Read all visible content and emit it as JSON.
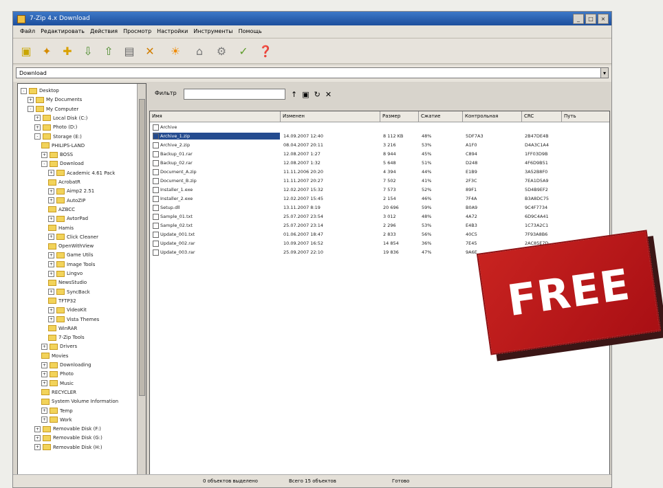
{
  "window": {
    "title": "7-Zip 4.x Download",
    "minimize_label": "_",
    "maximize_label": "□",
    "close_label": "×"
  },
  "menu": [
    "Файл",
    "Редактировать",
    "Действия",
    "Просмотр",
    "Настройки",
    "Инструменты",
    "Помощь"
  ],
  "address": {
    "value": "Download",
    "dropdown_label": "▾"
  },
  "filter": {
    "label": "Фильтр",
    "value": ""
  },
  "tree": [
    {
      "label": "Desktop",
      "level": 0,
      "expander": "-"
    },
    {
      "label": "My Documents",
      "level": 1,
      "expander": "+"
    },
    {
      "label": "My Computer",
      "level": 1,
      "expander": "-"
    },
    {
      "label": "Local Disk (C:)",
      "level": 2,
      "expander": "+"
    },
    {
      "label": "Photo (D:)",
      "level": 2,
      "expander": "+"
    },
    {
      "label": "Storage (E:)",
      "level": 2,
      "expander": "-"
    },
    {
      "label": "PHILIPS-LAND",
      "level": 3,
      "expander": ""
    },
    {
      "label": "BOSS",
      "level": 3,
      "expander": "+"
    },
    {
      "label": "Download",
      "level": 3,
      "expander": "-"
    },
    {
      "label": "Academic 4.61 Pack",
      "level": 4,
      "expander": "+"
    },
    {
      "label": "AcrobatR",
      "level": 4,
      "expander": ""
    },
    {
      "label": "Aimp2 2.51",
      "level": 4,
      "expander": "+"
    },
    {
      "label": "AutoZIP",
      "level": 4,
      "expander": "+"
    },
    {
      "label": "AZBCC",
      "level": 4,
      "expander": ""
    },
    {
      "label": "AvtorPad",
      "level": 4,
      "expander": "+"
    },
    {
      "label": "Hamis",
      "level": 4,
      "expander": ""
    },
    {
      "label": "Click Cleaner",
      "level": 4,
      "expander": "+"
    },
    {
      "label": "OpenWithView",
      "level": 4,
      "expander": ""
    },
    {
      "label": "Game Utils",
      "level": 4,
      "expander": "+"
    },
    {
      "label": "Image Tools",
      "level": 4,
      "expander": "+"
    },
    {
      "label": "Lingvo",
      "level": 4,
      "expander": "+"
    },
    {
      "label": "NewsStudio",
      "level": 4,
      "expander": ""
    },
    {
      "label": "SyncBack",
      "level": 4,
      "expander": "+"
    },
    {
      "label": "TFTP32",
      "level": 4,
      "expander": ""
    },
    {
      "label": "VideoKit",
      "level": 4,
      "expander": "+"
    },
    {
      "label": "Vista Themes",
      "level": 4,
      "expander": "+"
    },
    {
      "label": "WinRAR",
      "level": 4,
      "expander": ""
    },
    {
      "label": "7-Zip Tools",
      "level": 4,
      "expander": ""
    },
    {
      "label": "Drivers",
      "level": 3,
      "expander": "+"
    },
    {
      "label": "Movies",
      "level": 3,
      "expander": ""
    },
    {
      "label": "Downloading",
      "level": 3,
      "expander": "+"
    },
    {
      "label": "Photo",
      "level": 3,
      "expander": "+"
    },
    {
      "label": "Music",
      "level": 3,
      "expander": "+"
    },
    {
      "label": "RECYCLER",
      "level": 3,
      "expander": ""
    },
    {
      "label": "System Volume Information",
      "level": 3,
      "expander": ""
    },
    {
      "label": "Temp",
      "level": 3,
      "expander": "+"
    },
    {
      "label": "Work",
      "level": 3,
      "expander": "+"
    },
    {
      "label": "Removable Disk (F:)",
      "level": 2,
      "expander": "+"
    },
    {
      "label": "Removable Disk (G:)",
      "level": 2,
      "expander": "+"
    },
    {
      "label": "Removable Disk (H:)",
      "level": 2,
      "expander": "+"
    }
  ],
  "table": {
    "headers": [
      "Имя",
      "Изменен",
      "Размер",
      "Сжатие",
      "Контрольная",
      "CRC",
      "Путь"
    ],
    "rows": [
      [
        "Archive",
        "",
        "",
        "",
        "",
        "",
        ""
      ],
      [
        "Archive_1.zip",
        "14.09.2007 12:40",
        "8 112 KB",
        "48%",
        "5DF7A3",
        "2B47DE4B",
        ""
      ],
      [
        "Archive_2.zip",
        "08.04.2007 20:11",
        "3 216",
        "53%",
        "A1F0",
        "D4A3C1A4",
        ""
      ],
      [
        "Backup_01.rar",
        "12.08.2007 1:27",
        "8 944",
        "45%",
        "C894",
        "1FF03D9B",
        ""
      ],
      [
        "Backup_02.rar",
        "12.08.2007 1:32",
        "5 648",
        "51%",
        "D248",
        "4F6D9B51",
        ""
      ],
      [
        "Document_A.zip",
        "11.11.2006 20:20",
        "4 394",
        "44%",
        "E1B9",
        "3A52B8F0",
        ""
      ],
      [
        "Document_B.zip",
        "11.11.2007 20:27",
        "7 502",
        "41%",
        "2F3C",
        "7EA1D5A9",
        ""
      ],
      [
        "Installer_1.exe",
        "12.02.2007 15:32",
        "7 573",
        "52%",
        "89F1",
        "5D4B9EF2",
        ""
      ],
      [
        "Installer_2.exe",
        "12.02.2007 15:45",
        "2 154",
        "46%",
        "7F4A",
        "B3A8DC75",
        ""
      ],
      [
        "Setup.dll",
        "13.11.2007 8:19",
        "20 696",
        "59%",
        "B0A9",
        "9C4F7734",
        ""
      ],
      [
        "Sample_01.txt",
        "25.07.2007 23:54",
        "3 012",
        "48%",
        "4A72",
        "6D9C4A41",
        ""
      ],
      [
        "Sample_02.txt",
        "25.07.2007 23:14",
        "2 296",
        "53%",
        "E4B3",
        "1C73A2C1",
        ""
      ],
      [
        "Update_001.txt",
        "01.06.2007 18:47",
        "2 833",
        "56%",
        "40C5",
        "7F93A8B6",
        ""
      ],
      [
        "Update_002.rar",
        "10.09.2007 16:52",
        "14 854",
        "36%",
        "7E45",
        "2AC85E7D",
        ""
      ],
      [
        "Update_003.rar",
        "25.09.2007 22:10",
        "19 836",
        "47%",
        "9A6E",
        "1B6A6F52",
        ""
      ]
    ]
  },
  "status": [
    "0 объектов выделено",
    "Всего 15 объектов",
    "Готово"
  ],
  "badge": {
    "text": "FREE"
  },
  "colors": {
    "badge_red": "#c82320",
    "titlebar_blue": "#2f68b8"
  }
}
